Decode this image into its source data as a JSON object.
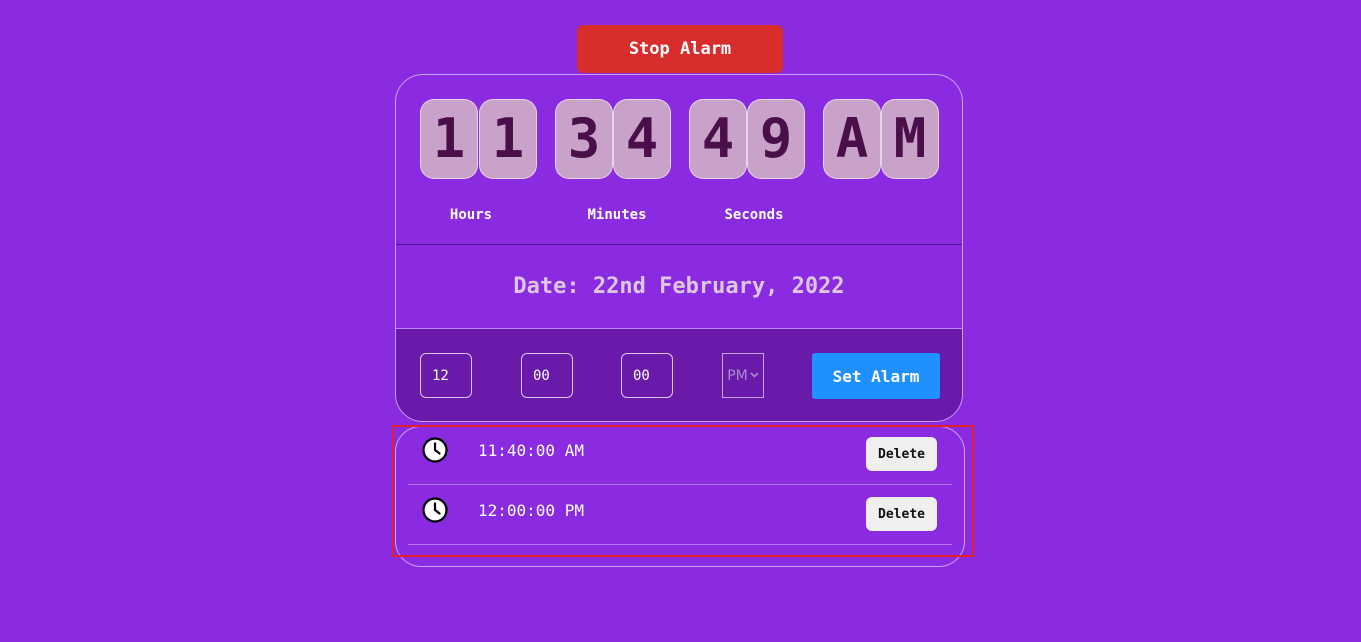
{
  "stop_alarm_label": "Stop Alarm",
  "clock": {
    "digits": {
      "hours": [
        "1",
        "1"
      ],
      "minutes": [
        "3",
        "4"
      ],
      "seconds": [
        "4",
        "9"
      ],
      "ampm": [
        "A",
        "M"
      ]
    },
    "labels": {
      "hours": "Hours",
      "minutes": "Minutes",
      "seconds": "Seconds"
    }
  },
  "date_text": "Date: 22nd February, 2022",
  "alarm_form": {
    "hour_value": "12",
    "minute_value": "00",
    "second_value": "00",
    "ampm_value": "PM",
    "set_label": "Set Alarm"
  },
  "alarms": [
    {
      "time": "11:40:00 AM",
      "delete_label": "Delete"
    },
    {
      "time": "12:00:00 PM",
      "delete_label": "Delete"
    }
  ],
  "icons": {
    "alarm_item": "clock-icon",
    "select_arrow": "chevron-down-icon"
  },
  "colors": {
    "background": "#8a2be2",
    "stop_button": "#d92d2d",
    "digit_tile": "#c8a2c8",
    "digit_text": "#4a0f4a",
    "form_panel": "#6a1aab",
    "set_button": "#1e90ff",
    "highlight_border": "#e0202a"
  }
}
